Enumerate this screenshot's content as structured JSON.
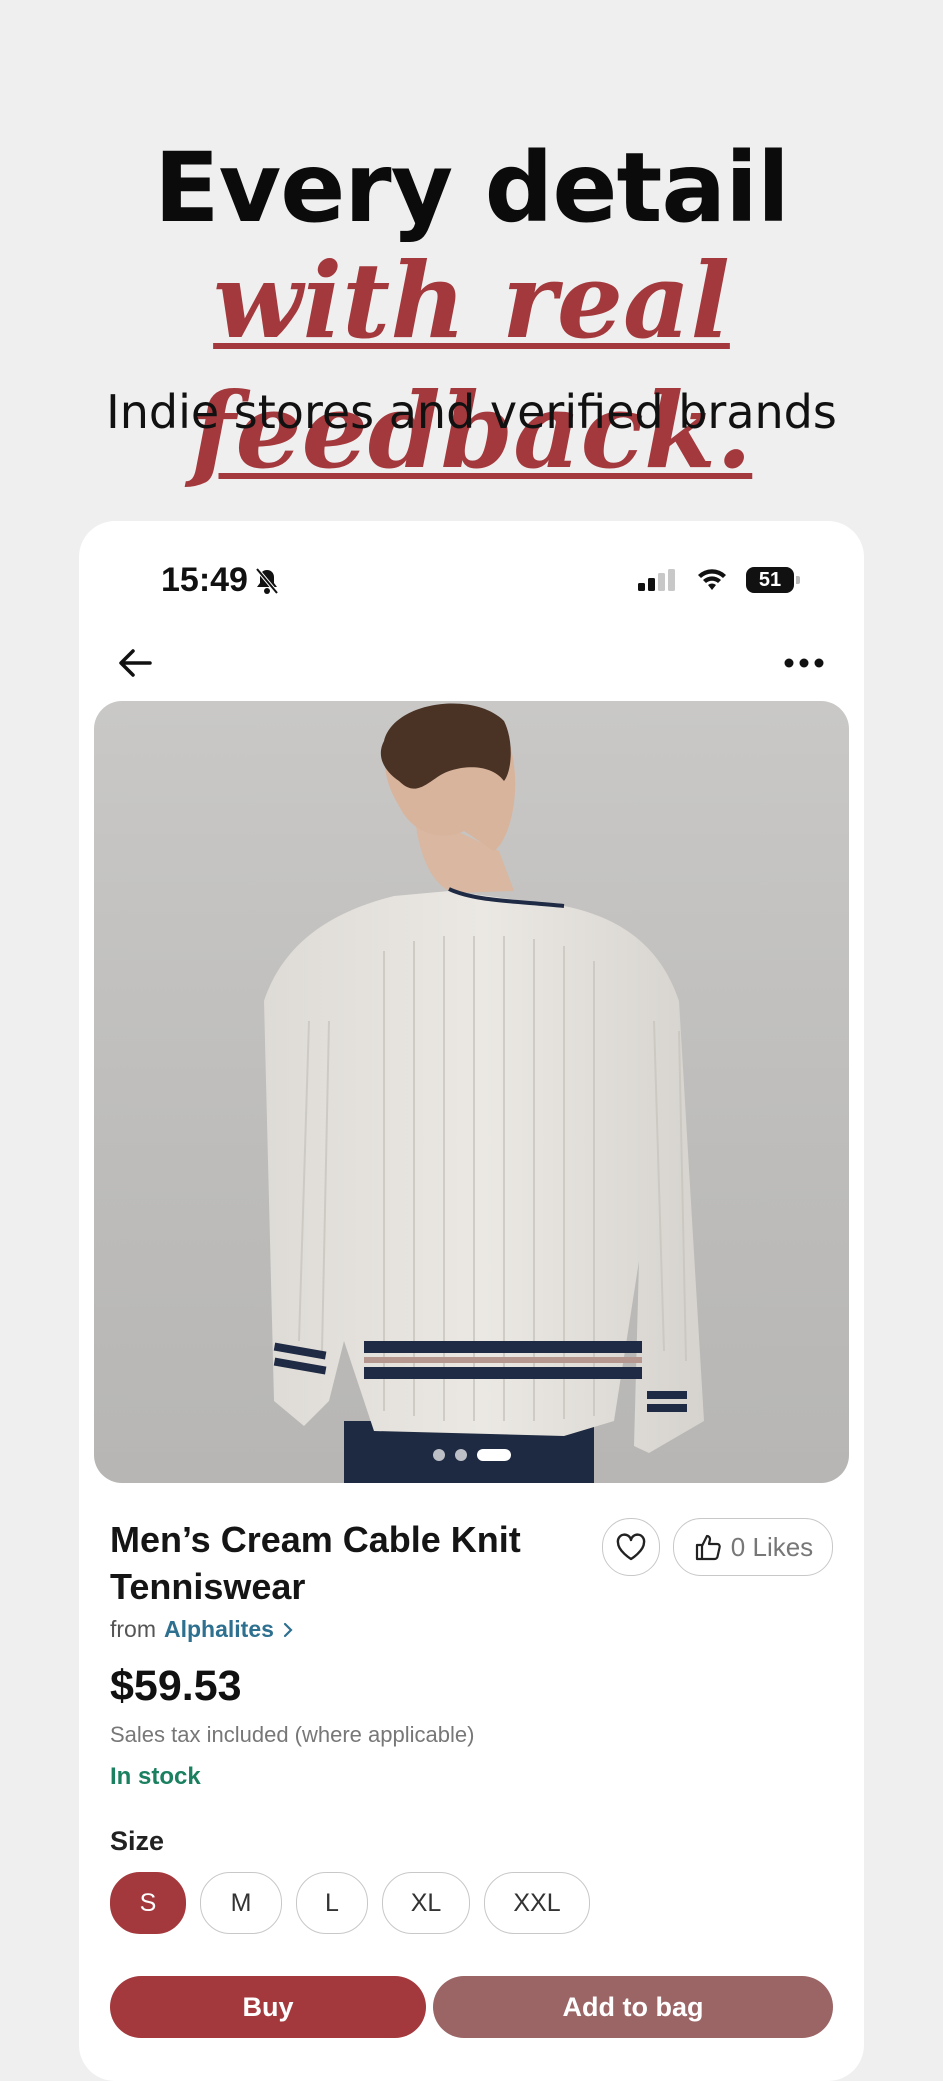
{
  "hero": {
    "title": "Every detail",
    "accent": "with real feedback.",
    "subtitle": "Indie stores and verified brands"
  },
  "status_bar": {
    "time": "15:49",
    "battery": "51",
    "icons": [
      "bell-slash-icon",
      "signal-icon",
      "wifi-icon",
      "battery-icon"
    ]
  },
  "nav": {
    "back_icon": "arrow-left-icon",
    "more_icon": "more-horizontal-icon"
  },
  "product": {
    "image_dots": 3,
    "active_dot": 3,
    "title": "Men’s Cream Cable Knit Tenniswear",
    "from_label": "from",
    "store": "Alphalites",
    "price": "$59.53",
    "tax_note": "Sales tax included (where applicable)",
    "stock": "In stock",
    "likes": "0 Likes",
    "size_label": "Size",
    "sizes": [
      "S",
      "M",
      "L",
      "XL",
      "XXL"
    ],
    "selected_size": "S",
    "buy_label": "Buy",
    "add_to_bag_label": "Add to bag"
  },
  "colors": {
    "accent": "#a4393d",
    "accent_muted": "#9b6465",
    "stock_green": "#1b8060",
    "link_blue": "#2e7090"
  }
}
